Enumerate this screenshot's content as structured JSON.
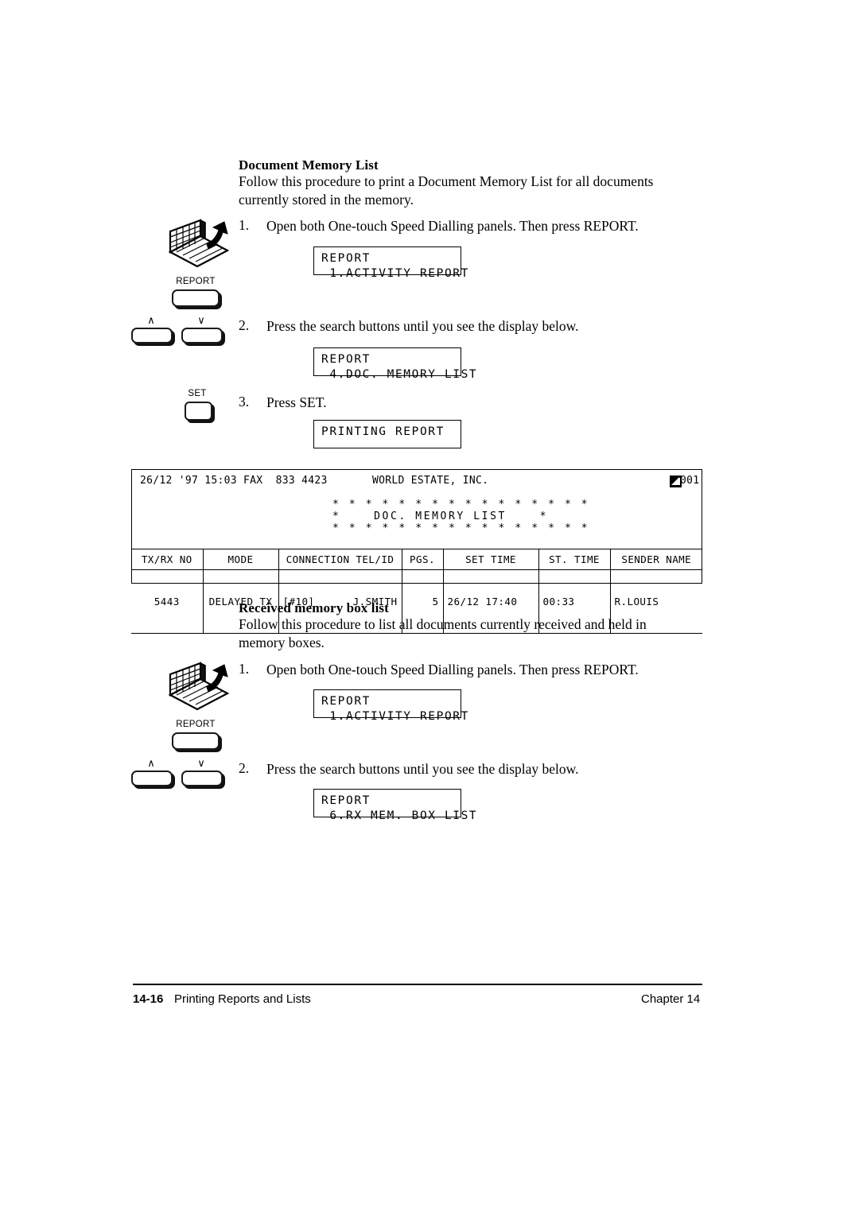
{
  "sections": [
    {
      "heading": "Document Memory List",
      "intro": "Follow this procedure to print a Document Memory List for all documents currently stored in the memory.",
      "steps": [
        {
          "num": "1.",
          "text": "Open both One-touch Speed Dialling panels. Then press REPORT."
        },
        {
          "num": "2.",
          "text": "Press the search buttons until you see the display below."
        },
        {
          "num": "3.",
          "text": "Press SET."
        }
      ],
      "displays": [
        {
          "line1": "REPORT",
          "line2": " 1.ACTIVITY REPORT"
        },
        {
          "line1": "REPORT",
          "line2": " 4.DOC. MEMORY LIST"
        },
        {
          "line1": "PRINTING REPORT",
          "line2": ""
        }
      ]
    },
    {
      "heading": "Received memory box list",
      "intro": "Follow this procedure to list all documents currently received and held in memory boxes.",
      "steps": [
        {
          "num": "1.",
          "text": "Open both One-touch Speed Dialling panels. Then press REPORT."
        },
        {
          "num": "2.",
          "text": "Press the search buttons until you see the display below."
        }
      ],
      "displays": [
        {
          "line1": "REPORT",
          "line2": " 1.ACTIVITY REPORT"
        },
        {
          "line1": "REPORT",
          "line2": " 6.RX MEM. BOX LIST"
        }
      ]
    }
  ],
  "keys": {
    "report_label": "REPORT",
    "set_label": "SET",
    "search_up_label": "∧",
    "search_down_label": "∨"
  },
  "report_printout": {
    "header_left": "26/12 '97 15:03 FAX  833 4423",
    "header_company": "WORLD ESTATE, INC.",
    "page_counter": "001",
    "page_icon": "page-icon",
    "star_row": "* * * * * * * * * * * * * * * *",
    "title_row": "*    DOC. MEMORY LIST    *",
    "columns": [
      "TX/RX NO",
      "MODE",
      "CONNECTION TEL/ID",
      "PGS.",
      "SET TIME",
      "ST. TIME",
      "SENDER NAME"
    ],
    "rows": [
      {
        "txrx_no": "5443",
        "mode": "DELAYED TX",
        "tel_id_left": "[#10]",
        "tel_id_right": "J.SMITH",
        "pgs": "5",
        "set_time": "26/12 17:40",
        "st_time": "00:33",
        "sender_name": "R.LOUIS"
      }
    ]
  },
  "footer": {
    "page_number": "14-16",
    "section_title": "Printing Reports and Lists",
    "chapter": "Chapter 14"
  }
}
